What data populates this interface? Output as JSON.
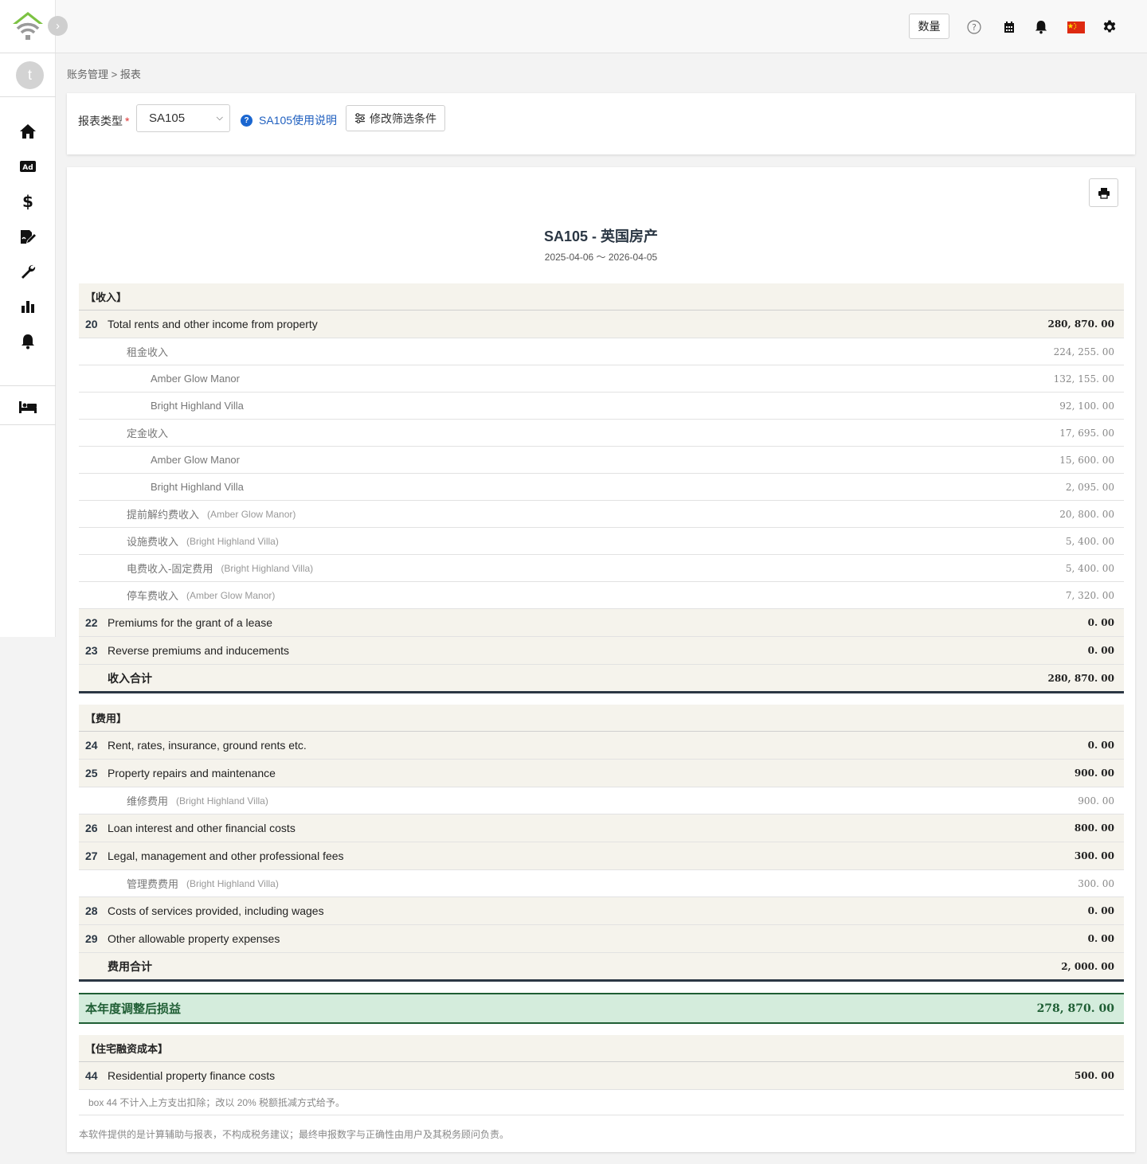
{
  "topbar": {
    "quantity_button": "数量",
    "icons": [
      "help-icon",
      "calendar-icon",
      "bell-icon",
      "china-flag-icon",
      "gear-icon"
    ]
  },
  "sidebar": {
    "avatar_letter": "t",
    "items": [
      "home-icon",
      "ad-icon",
      "dollar-icon",
      "signature-icon",
      "wrench-icon",
      "chart-icon",
      "bell-icon",
      "bed-icon"
    ]
  },
  "breadcrumb": "账务管理 > 报表",
  "filter": {
    "label": "报表类型",
    "required_mark": "*",
    "selected": "SA105",
    "help_text": "SA105使用说明",
    "modify_label": "修改筛选条件"
  },
  "report": {
    "title": "SA105 - 英国房产",
    "period": "2025-04-06 ～ 2026-04-05",
    "income_header": "【收入】",
    "income_rows": [
      {
        "kind": "main",
        "box": "20",
        "label": "Total rents and other income from property",
        "amount": "280, 870. 00"
      },
      {
        "kind": "sub",
        "label": "租金收入",
        "prop": "",
        "amount": "224, 255. 00"
      },
      {
        "kind": "subsub",
        "label": "Amber Glow Manor",
        "prop": "",
        "amount": "132, 155. 00"
      },
      {
        "kind": "subsub",
        "label": "Bright Highland Villa",
        "prop": "",
        "amount": "92, 100. 00"
      },
      {
        "kind": "sub",
        "label": "定金收入",
        "prop": "",
        "amount": "17, 695. 00"
      },
      {
        "kind": "subsub",
        "label": "Amber Glow Manor",
        "prop": "",
        "amount": "15, 600. 00"
      },
      {
        "kind": "subsub",
        "label": "Bright Highland Villa",
        "prop": "",
        "amount": "2, 095. 00"
      },
      {
        "kind": "sub",
        "label": "提前解约费收入",
        "prop": "(Amber Glow Manor)",
        "amount": "20, 800. 00"
      },
      {
        "kind": "sub",
        "label": "设施费收入",
        "prop": "(Bright Highland Villa)",
        "amount": "5, 400. 00"
      },
      {
        "kind": "sub",
        "label": "电费收入-固定费用",
        "prop": "(Bright Highland Villa)",
        "amount": "5, 400. 00"
      },
      {
        "kind": "sub",
        "label": "停车费收入",
        "prop": "(Amber Glow Manor)",
        "amount": "7, 320. 00"
      },
      {
        "kind": "main",
        "box": "22",
        "label": "Premiums for the grant of a lease",
        "amount": "0. 00"
      },
      {
        "kind": "main",
        "box": "23",
        "label": "Reverse premiums and inducements",
        "amount": "0. 00"
      }
    ],
    "income_total_label": "收入合计",
    "income_total": "280, 870. 00",
    "expense_header": "【费用】",
    "expense_rows": [
      {
        "kind": "main",
        "box": "24",
        "label": "Rent, rates, insurance, ground rents etc.",
        "amount": "0. 00"
      },
      {
        "kind": "main",
        "box": "25",
        "label": "Property repairs and maintenance",
        "amount": "900. 00"
      },
      {
        "kind": "sub",
        "label": "维修费用",
        "prop": "(Bright Highland Villa)",
        "amount": "900. 00"
      },
      {
        "kind": "main",
        "box": "26",
        "label": "Loan interest and other financial costs",
        "amount": "800. 00"
      },
      {
        "kind": "main",
        "box": "27",
        "label": "Legal, management and other professional fees",
        "amount": "300. 00"
      },
      {
        "kind": "sub",
        "label": "管理费费用",
        "prop": "(Bright Highland Villa)",
        "amount": "300. 00"
      },
      {
        "kind": "main",
        "box": "28",
        "label": "Costs of services provided, including wages",
        "amount": "0. 00"
      },
      {
        "kind": "main",
        "box": "29",
        "label": "Other allowable property expenses",
        "amount": "0. 00"
      }
    ],
    "expense_total_label": "费用合计",
    "expense_total": "2, 000. 00",
    "net_label": "本年度调整后损益",
    "net_amount": "278, 870. 00",
    "finance_header": "【住宅融资成本】",
    "finance_box": "44",
    "finance_label": "Residential property finance costs",
    "finance_amount": "500. 00",
    "finance_note": "box 44 不计入上方支出扣除；改以 20% 税额抵减方式给予。",
    "disclaimer": "本软件提供的是计算辅助与报表，不构成税务建议；最终申报数字与正确性由用户及其税务顾问负责。"
  },
  "colors": {
    "accent_green": "#1f5e34",
    "net_bg": "#d4ecdc",
    "row_bg": "#f5f3ec",
    "link_blue": "#1f5fbf",
    "logo_green": "#7cc242"
  }
}
